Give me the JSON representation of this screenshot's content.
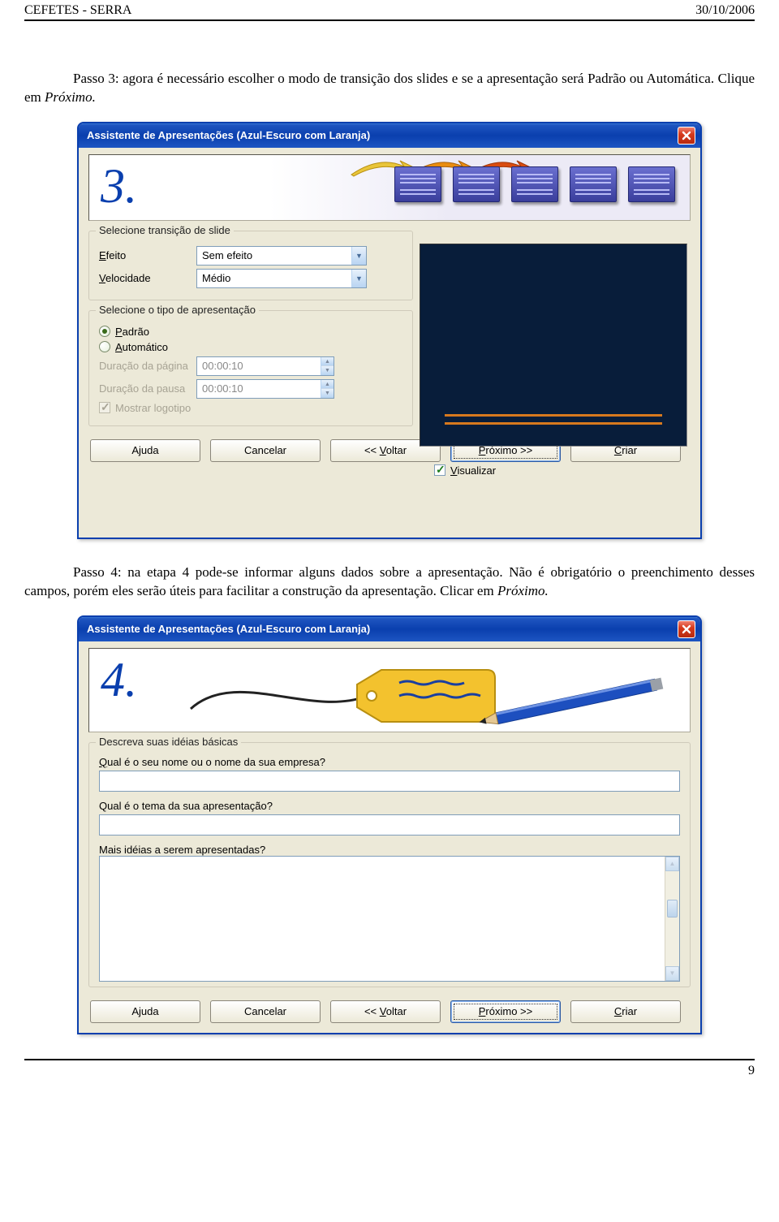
{
  "header": {
    "left": "CEFETES - SERRA",
    "right": "30/10/2006"
  },
  "page_number": "9",
  "para1_a": "Passo 3: agora é necessário escolher o modo de transição dos slides e se a apresentação será Padrão ou Automática. Clique em ",
  "para1_b": "Próximo.",
  "para2_a": "Passo 4: na etapa 4 pode-se informar alguns dados sobre a apresentação. Não é obrigatório o preenchimento desses campos, porém eles serão úteis para facilitar a construção da apresentação. Clicar em ",
  "para2_b": "Próximo.",
  "dialog3": {
    "title": "Assistente de Apresentações (Azul-Escuro com Laranja)",
    "step_num": "3.",
    "group_transition_legend": "Selecione transição de slide",
    "label_efeito": "Efeito",
    "efeito_value": "Sem efeito",
    "label_velocidade": "Velocidade",
    "velocidade_value": "Médio",
    "group_tipo_legend": "Selecione o tipo de apresentação",
    "radio_padrao": "Padrão",
    "radio_automatico": "Automático",
    "label_duracao_pagina": "Duração da página",
    "duracao_pagina_value": "00:00:10",
    "label_duracao_pausa": "Duração da pausa",
    "duracao_pausa_value": "00:00:10",
    "check_logotipo": "Mostrar logotipo",
    "check_visualizar": "Visualizar",
    "btn_ajuda": "Ajuda",
    "btn_cancelar": "Cancelar",
    "btn_voltar": "<< Voltar",
    "btn_proximo": "Próximo >>",
    "btn_criar": "Criar"
  },
  "dialog4": {
    "title": "Assistente de Apresentações (Azul-Escuro com Laranja)",
    "step_num": "4.",
    "group_legend": "Descreva suas idéias básicas",
    "q1": "Qual é o seu nome ou o nome da sua empresa?",
    "q2": "Qual é o tema da sua apresentação?",
    "q3": "Mais idéias a serem apresentadas?",
    "btn_ajuda": "Ajuda",
    "btn_cancelar": "Cancelar",
    "btn_voltar": "<< Voltar",
    "btn_proximo": "Próximo >>",
    "btn_criar": "Criar"
  }
}
